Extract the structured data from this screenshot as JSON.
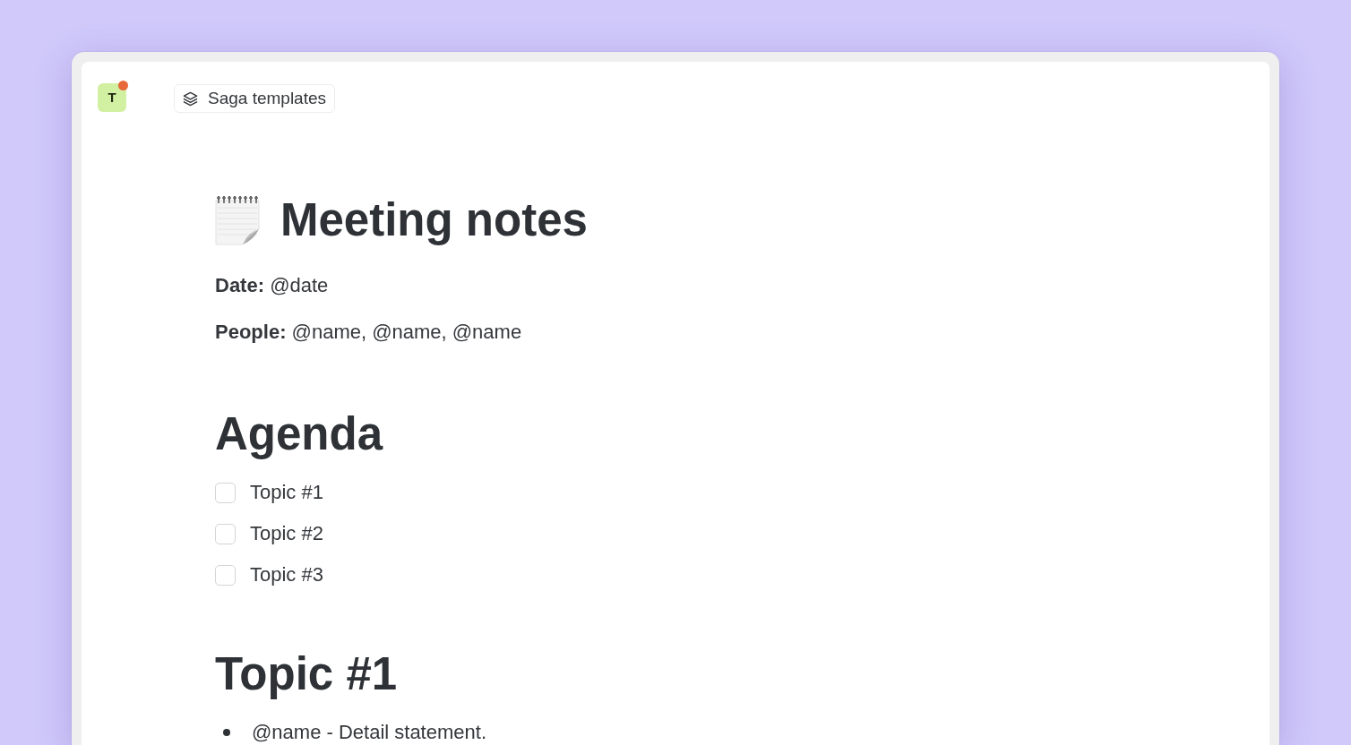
{
  "header": {
    "avatar": {
      "initial": "T",
      "notification": true
    },
    "template_button": {
      "label": "Saga templates"
    }
  },
  "document": {
    "title": "Meeting notes",
    "fields": [
      "**Date:** @date",
      "**People:** @name, @name, @name"
    ],
    "sections": [
      {
        "heading": "Agenda",
        "items": [
          {
            "kind": "checkbox",
            "text": "Topic #1",
            "checked": false
          },
          {
            "kind": "checkbox",
            "text": "Topic #2",
            "checked": false
          },
          {
            "kind": "checkbox",
            "text": "Topic #3",
            "checked": false
          }
        ]
      },
      {
        "heading": "Topic #1",
        "items": [
          {
            "kind": "bullet",
            "text": "@name - Detail statement."
          }
        ]
      }
    ]
  }
}
